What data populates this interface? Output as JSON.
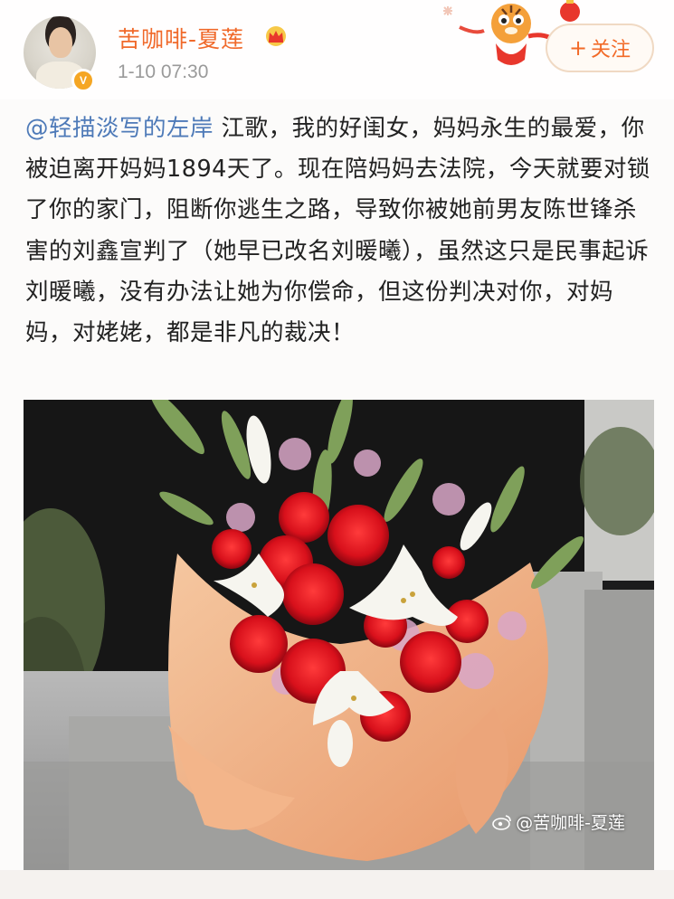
{
  "post": {
    "author": {
      "name": "苦咖啡-夏莲",
      "verified_badge": "V",
      "crown_icon": "crown-icon"
    },
    "time": "1-10 07:30",
    "follow_label": "关注",
    "follow_icon": "+",
    "mention": "@轻描淡写的左岸",
    "body": " 江歌，我的好闺女，妈妈永生的最爱，你被迫离开妈妈1894天了。现在陪妈妈去法院，今天就要对锁了你的家门，阻断你逃生之路，导致你被她前男友陈世锋杀害的刘鑫宣判了（她早已改名刘暖曦），虽然这只是民事起诉刘暖曦，没有办法让她为你偿命，但这份判决对你，对妈妈，对姥姥，都是非凡的裁决！",
    "image": {
      "watermark": "@苦咖啡-夏莲",
      "watermark_icon": "weibo-logo-icon"
    }
  },
  "colors": {
    "username": "#f0692a",
    "mention": "#4e7ab8",
    "follow": "#f26a28",
    "verified": "#f5a623"
  }
}
